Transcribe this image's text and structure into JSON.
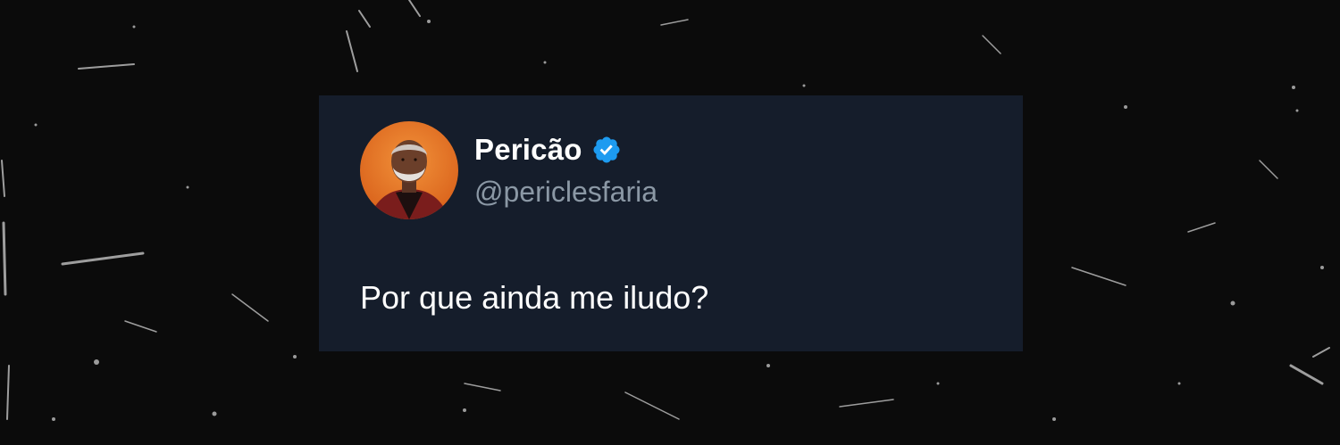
{
  "tweet": {
    "display_name": "Pericão",
    "handle": "@periclesfaria",
    "text": "Por que ainda me iludo?",
    "verified_icon": "verified-badge-icon",
    "avatar_icon": "profile-photo"
  },
  "colors": {
    "background": "#0b0b0b",
    "card_background": "#151d2b",
    "name_text": "#ffffff",
    "handle_text": "#8b98a5",
    "verified_badge": "#1d9bf0",
    "avatar_background": "#e9731f"
  }
}
